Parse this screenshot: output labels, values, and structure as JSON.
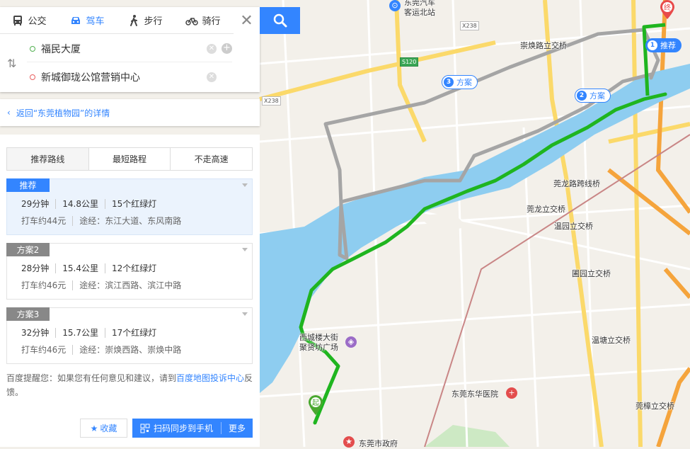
{
  "map": {
    "labels": [
      {
        "id": "bus-station",
        "text": "东莞汽车\n客运北站"
      },
      {
        "id": "chonghuan-bridge",
        "text": "崇焕路立交桥"
      },
      {
        "id": "guanlong-bridge",
        "text": "莞龙路跨线桥"
      },
      {
        "id": "guanlong-interchange",
        "text": "莞龙立交桥"
      },
      {
        "id": "wenyuan-bridge",
        "text": "温园立交桥"
      },
      {
        "id": "huiyuan-bridge",
        "text": "圃园立交桥"
      },
      {
        "id": "wentang-bridge",
        "text": "温塘立交桥"
      },
      {
        "id": "guanzhang-bridge",
        "text": "莞樟立交桥"
      },
      {
        "id": "xichenglou",
        "text": "西城楼大街\n聚贤坊广场"
      },
      {
        "id": "dongguan-east-hospital",
        "text": "东莞东华医院"
      },
      {
        "id": "city-gov",
        "text": "东莞市政府"
      }
    ],
    "road_tags": [
      {
        "id": "x238-top",
        "text": "X238"
      },
      {
        "id": "s120",
        "text": "S120"
      },
      {
        "id": "x238-left",
        "text": "X238"
      }
    ],
    "route_bubbles": [
      {
        "id": "route-1",
        "num": "1",
        "text": "推荐"
      },
      {
        "id": "route-2",
        "num": "2",
        "text": "方案"
      },
      {
        "id": "route-3",
        "num": "3",
        "text": "方案"
      }
    ],
    "end_marker": "终",
    "start_marker": "起",
    "colors": {
      "recommended_route": "#1fb51f",
      "alt_route": "#a5a5a5",
      "river": "#7fc7f0"
    }
  },
  "search": {
    "modes": [
      {
        "label": "公交",
        "icon": "bus-icon"
      },
      {
        "label": "驾车",
        "icon": "car-icon"
      },
      {
        "label": "步行",
        "icon": "walk-icon"
      },
      {
        "label": "骑行",
        "icon": "bike-icon"
      }
    ],
    "active_mode": "驾车",
    "origin": "福民大厦",
    "destination": "新城御珑公馆营销中心",
    "close_glyph": "✕"
  },
  "back_link": "返回“东莞植物园”的详情",
  "preferences": {
    "tabs": [
      "推荐路线",
      "最短路程",
      "不走高速"
    ],
    "active": "推荐路线"
  },
  "routes": [
    {
      "tag": "推荐",
      "time": "29分钟",
      "distance": "14.8公里",
      "lights": "15个红绿灯",
      "taxi": "打车约44元",
      "via": "途经：东江大道、东风南路"
    },
    {
      "tag": "方案2",
      "time": "28分钟",
      "distance": "15.4公里",
      "lights": "12个红绿灯",
      "taxi": "打车约46元",
      "via": "途经：滨江西路、滨江中路"
    },
    {
      "tag": "方案3",
      "time": "32分钟",
      "distance": "15.7公里",
      "lights": "17个红绿灯",
      "taxi": "打车约46元",
      "via": "途经：崇焕西路、崇焕中路"
    }
  ],
  "tip": {
    "prefix": "百度提醒您：如果您有任何意见和建议，请到",
    "link": "百度地图投诉中心",
    "suffix": "反馈。"
  },
  "buttons": {
    "favorite": "收藏",
    "sync": "扫码同步到手机",
    "more": "更多"
  }
}
